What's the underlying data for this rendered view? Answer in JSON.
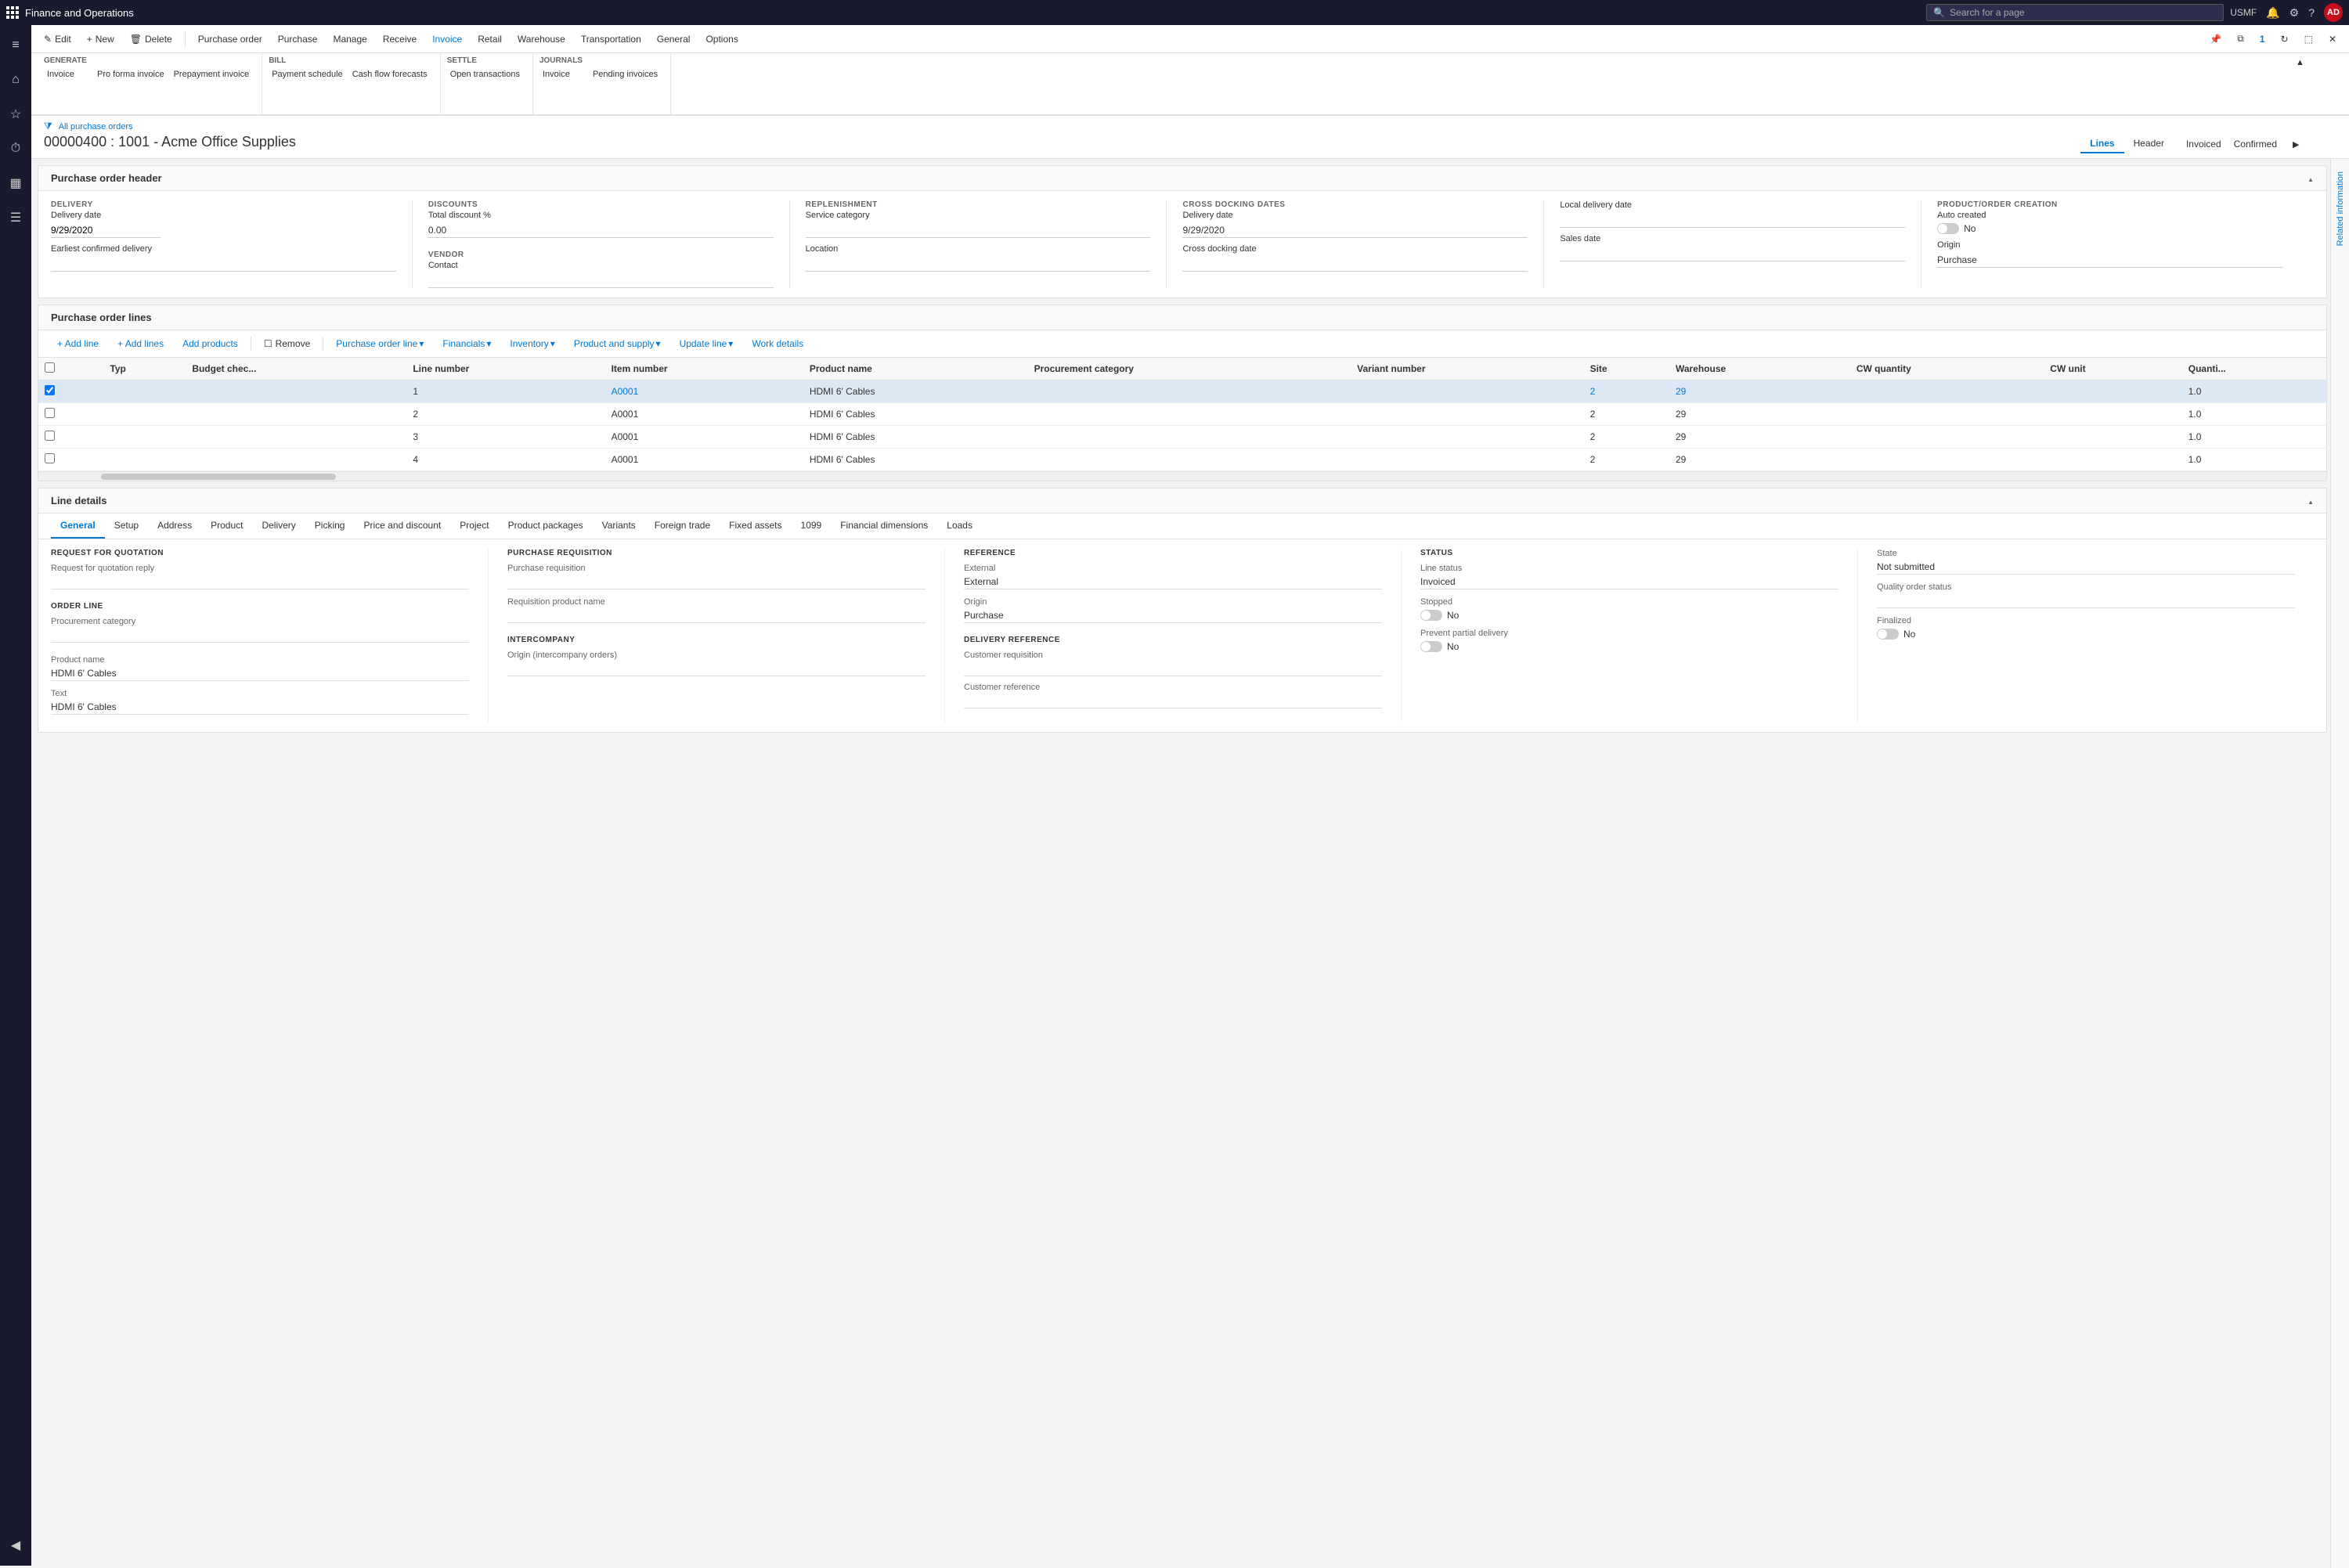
{
  "app": {
    "title": "Finance and Operations",
    "user": "USMF",
    "user_initials": "AD",
    "search_placeholder": "Search for a page"
  },
  "command_bar": {
    "edit_label": "Edit",
    "new_label": "New",
    "delete_label": "Delete",
    "menu_items": [
      "Purchase order",
      "Purchase",
      "Manage",
      "Receive",
      "Invoice",
      "Retail",
      "Warehouse",
      "Transportation",
      "General",
      "Options"
    ]
  },
  "ribbon": {
    "active_tab": "Invoice",
    "generate_group": {
      "title": "Generate",
      "items": [
        "Invoice",
        "Pro forma invoice",
        "Prepayment invoice"
      ]
    },
    "bill_group": {
      "title": "Bill",
      "items": [
        "Payment schedule",
        "Cash flow forecasts"
      ]
    },
    "settle_group": {
      "title": "Settle",
      "items": [
        "Open transactions"
      ]
    },
    "journals_group": {
      "title": "Journals",
      "items": [
        "Invoice",
        "Pending invoices"
      ]
    }
  },
  "breadcrumb": "All purchase orders",
  "page_title": "00000400 : 1001 - Acme Office Supplies",
  "tabs": {
    "lines": "Lines",
    "header": "Header",
    "active": "Lines"
  },
  "status": {
    "invoiced": "Invoiced",
    "confirmed": "Confirmed"
  },
  "purchase_header": {
    "title": "Purchase order header",
    "delivery": {
      "label": "DELIVERY",
      "delivery_date_label": "Delivery date",
      "delivery_date_value": "9/29/2020",
      "earliest_confirmed_label": "Earliest confirmed delivery"
    },
    "discounts": {
      "label": "DISCOUNTS",
      "total_discount_label": "Total discount %",
      "total_discount_value": "0.00"
    },
    "replenishment": {
      "label": "REPLENISHMENT",
      "service_category_label": "Service category",
      "location_label": "Location"
    },
    "cross_docking": {
      "label": "CROSS DOCKING DATES",
      "delivery_date_label": "Delivery date",
      "delivery_date_value": "9/29/2020",
      "cross_docking_date_label": "Cross docking date"
    },
    "local_delivery": {
      "local_delivery_date_label": "Local delivery date",
      "sales_date_label": "Sales date"
    },
    "vendor": {
      "label": "VENDOR",
      "contact_label": "Contact"
    },
    "product_order_creation": {
      "label": "PRODUCT/ORDER CREATION",
      "auto_created_label": "Auto created",
      "auto_created_value": "No",
      "origin_label": "Origin",
      "origin_value": "Purchase"
    }
  },
  "purchase_lines": {
    "title": "Purchase order lines",
    "toolbar": {
      "add_line": "+ Add line",
      "add_lines": "+ Add lines",
      "add_products": "Add products",
      "remove": "Remove",
      "purchase_order_line": "Purchase order line",
      "financials": "Financials",
      "inventory": "Inventory",
      "product_and_supply": "Product and supply",
      "update_line": "Update line",
      "work_details": "Work details"
    },
    "columns": {
      "check": "",
      "type": "Typ",
      "budget_check": "Budget chec...",
      "line_number": "Line number",
      "item_number": "Item number",
      "product_name": "Product name",
      "procurement_category": "Procurement category",
      "variant_number": "Variant number",
      "site": "Site",
      "warehouse": "Warehouse",
      "cw_quantity": "CW quantity",
      "cw_unit": "CW unit",
      "quantity": "Quanti..."
    },
    "rows": [
      {
        "line_number": "1",
        "item_number": "A0001",
        "product_name": "HDMI 6' Cables",
        "procurement_category": "",
        "variant_number": "",
        "site": "2",
        "warehouse": "29",
        "cw_quantity": "",
        "cw_unit": "",
        "quantity": "1.0",
        "selected": true
      },
      {
        "line_number": "2",
        "item_number": "A0001",
        "product_name": "HDMI 6' Cables",
        "procurement_category": "",
        "variant_number": "",
        "site": "2",
        "warehouse": "29",
        "cw_quantity": "",
        "cw_unit": "",
        "quantity": "1.0",
        "selected": false
      },
      {
        "line_number": "3",
        "item_number": "A0001",
        "product_name": "HDMI 6' Cables",
        "procurement_category": "",
        "variant_number": "",
        "site": "2",
        "warehouse": "29",
        "cw_quantity": "",
        "cw_unit": "",
        "quantity": "1.0",
        "selected": false
      },
      {
        "line_number": "4",
        "item_number": "A0001",
        "product_name": "HDMI 6' Cables",
        "procurement_category": "",
        "variant_number": "",
        "site": "2",
        "warehouse": "29",
        "cw_quantity": "",
        "cw_unit": "",
        "quantity": "1.0",
        "selected": false
      }
    ]
  },
  "line_details": {
    "title": "Line details",
    "tabs": [
      "General",
      "Setup",
      "Address",
      "Product",
      "Delivery",
      "Picking",
      "Price and discount",
      "Project",
      "Product packages",
      "Variants",
      "Foreign trade",
      "Fixed assets",
      "1099",
      "Financial dimensions",
      "Loads"
    ],
    "active_tab": "General",
    "general": {
      "request_for_quotation": {
        "title": "REQUEST FOR QUOTATION",
        "reply_label": "Request for quotation reply"
      },
      "order_line": {
        "title": "ORDER LINE",
        "procurement_category_label": "Procurement category"
      },
      "product_name_label": "Product name",
      "product_name_value": "HDMI 6' Cables",
      "text_label": "Text",
      "text_value": "HDMI 6' Cables",
      "purchase_requisition": {
        "title": "PURCHASE REQUISITION",
        "purchase_requisition_label": "Purchase requisition",
        "requisition_product_name_label": "Requisition product name"
      },
      "intercompany": {
        "title": "INTERCOMPANY",
        "origin_label": "Origin (intercompany orders)"
      },
      "reference": {
        "title": "REFERENCE",
        "external_label": "External",
        "external_value": "External",
        "origin_label": "Origin",
        "origin_value": "Purchase"
      },
      "delivery_reference": {
        "title": "DELIVERY REFERENCE",
        "customer_requisition_label": "Customer requisition",
        "customer_reference_label": "Customer reference"
      },
      "status": {
        "title": "STATUS",
        "line_status_label": "Line status",
        "line_status_value": "Invoiced",
        "stopped_label": "Stopped",
        "stopped_value": "No",
        "prevent_partial_label": "Prevent partial delivery",
        "prevent_partial_value": "No"
      },
      "state": {
        "state_label": "State",
        "state_value": "Not submitted",
        "quality_order_status_label": "Quality order status",
        "finalized_label": "Finalized",
        "finalized_value": "No"
      }
    }
  },
  "side_panel": {
    "label": "Related information"
  },
  "icons": {
    "filter": "⧩",
    "chevron_right": "▶",
    "chevron_down": "▼",
    "chevron_up": "▲",
    "close": "✕",
    "back": "◀",
    "search": "🔍",
    "notification": "🔔",
    "settings": "⚙",
    "help": "?",
    "home": "⌂",
    "star": "☆",
    "history": "⏱",
    "grid": "▦",
    "list": "☰",
    "hamburger": "≡",
    "pen": "✎",
    "plus": "+",
    "trash": "🗑",
    "caret": "▾"
  }
}
